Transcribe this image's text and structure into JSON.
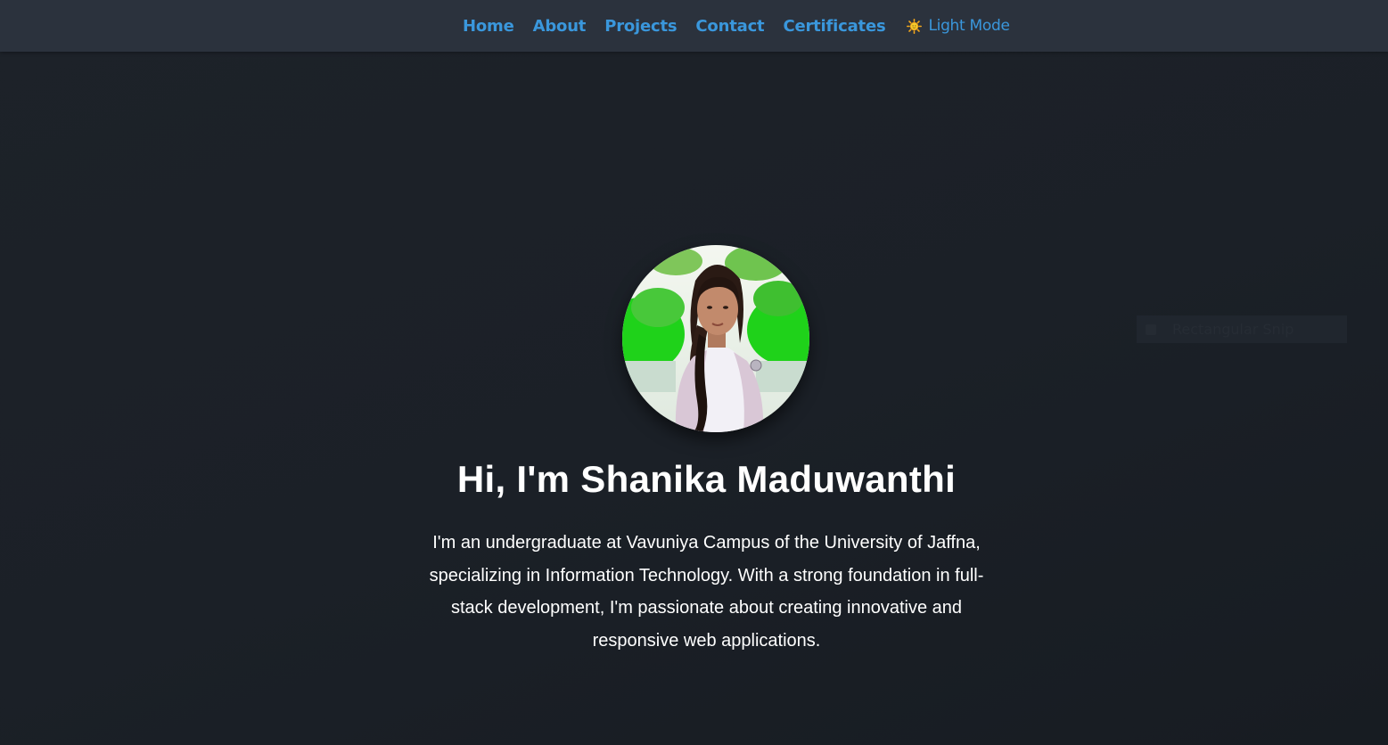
{
  "nav": {
    "links": [
      {
        "label": "Home"
      },
      {
        "label": "About"
      },
      {
        "label": "Projects"
      },
      {
        "label": "Contact"
      },
      {
        "label": "Certificates"
      }
    ],
    "theme_toggle": {
      "icon": "sun-icon",
      "label": "Light Mode"
    }
  },
  "hero": {
    "avatar_icon": "profile-photo",
    "title": "Hi, I'm Shanika Maduwanthi",
    "description": "I'm an undergraduate at Vavuniya Campus of the University of Jaffna, specializing in Information Technology. With a strong foundation in full-stack development, I'm passionate about creating innovative and responsive web applications."
  },
  "overlay": {
    "snip_label": "Rectangular Snip"
  },
  "colors": {
    "accent": "#3a97dc",
    "navbar_bg": "#2b323d",
    "page_bg": "#1d2229",
    "text": "#ffffff"
  }
}
